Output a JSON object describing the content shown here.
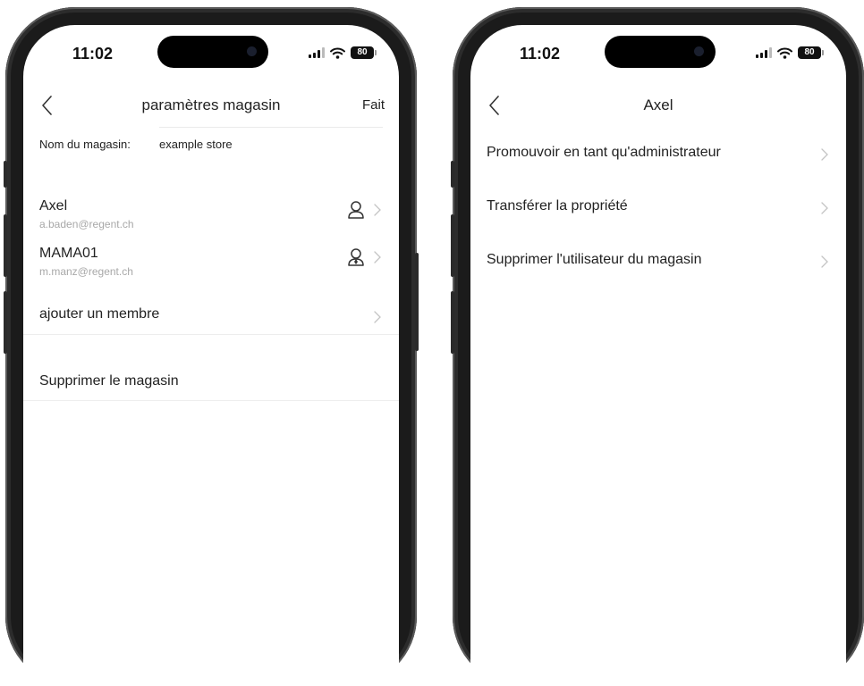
{
  "status_bar": {
    "time": "11:02",
    "battery": "80"
  },
  "left_screen": {
    "nav": {
      "title": "paramètres magasin",
      "done_label": "Fait"
    },
    "store_name": {
      "label": "Nom du magasin:",
      "value": "example store"
    },
    "members": [
      {
        "name": "Axel",
        "email": "a.baden@regent.ch",
        "role_icon": "user-icon"
      },
      {
        "name": "MAMA01",
        "email": "m.manz@regent.ch",
        "role_icon": "admin-user-icon"
      }
    ],
    "add_member_label": "ajouter un membre",
    "delete_store_label": "Supprimer le magasin"
  },
  "right_screen": {
    "nav": {
      "title": "Axel"
    },
    "actions": [
      {
        "label": "Promouvoir en tant qu'administrateur"
      },
      {
        "label": "Transférer la propriété"
      },
      {
        "label": "Supprimer l'utilisateur du magasin"
      }
    ]
  },
  "colors": {
    "frame": "#1b1b1b",
    "screen": "#ffffff",
    "text": "#222222",
    "secondary_text": "#a8a8a8",
    "chevron": "#c4c4c4",
    "divider": "#ededed"
  }
}
